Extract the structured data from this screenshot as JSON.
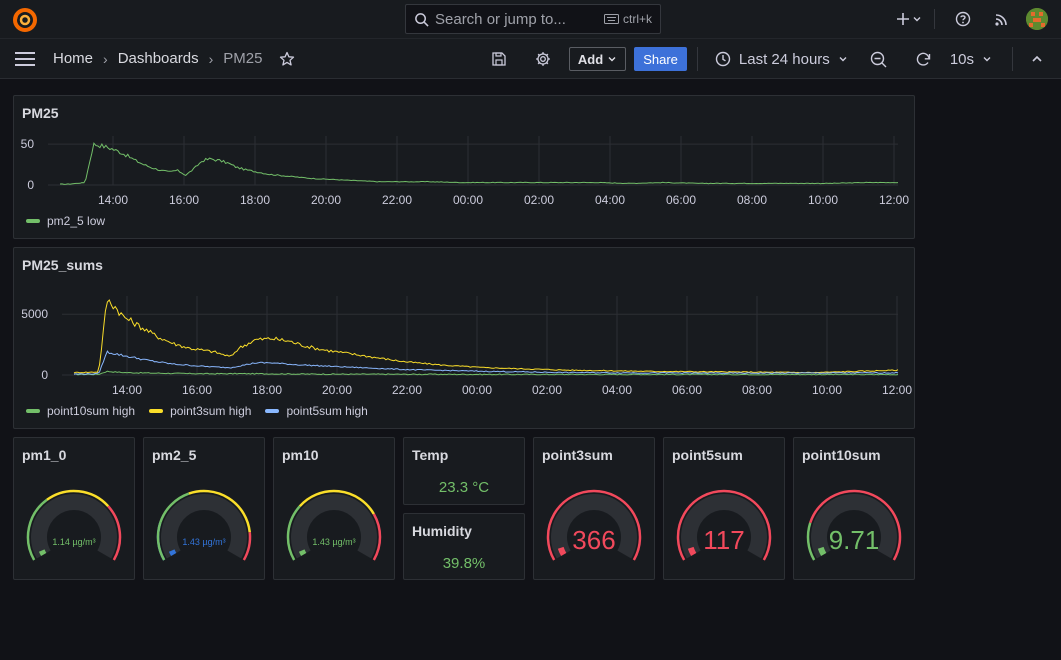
{
  "header": {
    "search_placeholder": "Search or jump to...",
    "search_shortcut": "ctrl+k",
    "icons": [
      "grafana-logo-icon",
      "search-icon",
      "keyboard-icon",
      "plus-icon",
      "chevron-down-icon",
      "help-icon",
      "news-icon",
      "avatar"
    ]
  },
  "nav": {
    "breadcrumbs": [
      "Home",
      "Dashboards",
      "PM25"
    ],
    "add_label": "Add",
    "share_label": "Share",
    "time_range": "Last 24 hours",
    "refresh_interval": "10s"
  },
  "colors": {
    "green": "#73bf69",
    "yellow": "#fade2a",
    "blue": "#8ab8ff",
    "red": "#f2495c",
    "blue_dark": "#3274d9",
    "orange": "#ff9830",
    "gauge_bg": "#2d3035"
  },
  "panels": {
    "pm25": {
      "title": "PM25",
      "legend": [
        "pm2_5 low"
      ],
      "chart_data": {
        "type": "line",
        "x_ticks": [
          "14:00",
          "16:00",
          "18:00",
          "20:00",
          "22:00",
          "00:00",
          "02:00",
          "04:00",
          "06:00",
          "08:00",
          "10:00",
          "12:00"
        ],
        "y_ticks": [
          "50",
          "0"
        ],
        "ylim": [
          0,
          60
        ],
        "grid": true,
        "series": [
          {
            "name": "pm2_5 low",
            "color": "#73bf69",
            "points": [
              [
                0,
                1
              ],
              [
                1,
                1
              ],
              [
                2,
                2
              ],
              [
                3,
                3
              ],
              [
                4,
                50
              ],
              [
                5,
                48
              ],
              [
                6,
                45
              ],
              [
                7,
                41
              ],
              [
                8,
                36
              ],
              [
                9,
                30
              ],
              [
                10,
                25
              ],
              [
                11,
                21
              ],
              [
                12,
                18
              ],
              [
                13,
                16
              ],
              [
                14,
                18
              ],
              [
                15,
                12
              ],
              [
                16,
                20
              ],
              [
                17,
                30
              ],
              [
                18,
                32
              ],
              [
                19,
                30
              ],
              [
                20,
                27
              ],
              [
                21,
                22
              ],
              [
                22,
                19
              ],
              [
                23,
                17
              ],
              [
                24,
                15
              ],
              [
                25,
                13
              ],
              [
                26,
                12
              ],
              [
                27,
                11
              ],
              [
                28,
                10
              ],
              [
                29,
                9
              ],
              [
                30,
                8
              ],
              [
                32,
                7
              ],
              [
                34,
                6
              ],
              [
                36,
                5
              ],
              [
                38,
                4
              ],
              [
                40,
                4
              ],
              [
                44,
                4
              ],
              [
                48,
                3
              ],
              [
                52,
                3
              ],
              [
                56,
                3
              ],
              [
                60,
                3
              ],
              [
                64,
                3
              ],
              [
                68,
                2
              ],
              [
                72,
                3
              ],
              [
                76,
                2
              ],
              [
                80,
                2
              ],
              [
                84,
                2
              ],
              [
                88,
                2
              ],
              [
                92,
                2
              ],
              [
                96,
                3
              ],
              [
                100,
                3
              ]
            ]
          }
        ]
      }
    },
    "pm25_sums": {
      "title": "PM25_sums",
      "legend": [
        "point10sum high",
        "point3sum high",
        "point5sum high"
      ],
      "chart_data": {
        "type": "line",
        "x_ticks": [
          "14:00",
          "16:00",
          "18:00",
          "20:00",
          "22:00",
          "00:00",
          "02:00",
          "04:00",
          "06:00",
          "08:00",
          "10:00",
          "12:00"
        ],
        "y_ticks": [
          "5000",
          "0"
        ],
        "ylim": [
          0,
          6500
        ],
        "grid": true,
        "series": [
          {
            "name": "point10sum high",
            "color": "#73bf69",
            "points": [
              [
                0,
                50
              ],
              [
                3,
                60
              ],
              [
                4,
                300
              ],
              [
                6,
                200
              ],
              [
                10,
                150
              ],
              [
                16,
                100
              ],
              [
                20,
                110
              ],
              [
                30,
                70
              ],
              [
                50,
                50
              ],
              [
                100,
                40
              ]
            ]
          },
          {
            "name": "point3sum high",
            "color": "#fade2a",
            "points": [
              [
                0,
                200
              ],
              [
                3,
                250
              ],
              [
                4,
                6200
              ],
              [
                5,
                5600
              ],
              [
                6,
                4800
              ],
              [
                8,
                4000
              ],
              [
                10,
                3200
              ],
              [
                12,
                2600
              ],
              [
                14,
                2200
              ],
              [
                16,
                2000
              ],
              [
                17,
                1900
              ],
              [
                18,
                1700
              ],
              [
                19,
                1500
              ],
              [
                20,
                2200
              ],
              [
                22,
                2900
              ],
              [
                24,
                3000
              ],
              [
                26,
                2800
              ],
              [
                28,
                2400
              ],
              [
                30,
                2100
              ],
              [
                33,
                1800
              ],
              [
                36,
                1500
              ],
              [
                40,
                1100
              ],
              [
                45,
                800
              ],
              [
                50,
                600
              ],
              [
                60,
                400
              ],
              [
                70,
                300
              ],
              [
                80,
                250
              ],
              [
                90,
                200
              ],
              [
                100,
                400
              ]
            ]
          },
          {
            "name": "point5sum high",
            "color": "#8ab8ff",
            "points": [
              [
                0,
                80
              ],
              [
                3,
                100
              ],
              [
                4,
                1900
              ],
              [
                6,
                1600
              ],
              [
                9,
                1200
              ],
              [
                12,
                900
              ],
              [
                16,
                700
              ],
              [
                19,
                600
              ],
              [
                22,
                1000
              ],
              [
                24,
                1000
              ],
              [
                27,
                850
              ],
              [
                30,
                750
              ],
              [
                35,
                600
              ],
              [
                40,
                450
              ],
              [
                50,
                300
              ],
              [
                60,
                200
              ],
              [
                80,
                150
              ],
              [
                100,
                180
              ]
            ]
          }
        ]
      }
    },
    "gauges": [
      {
        "title": "pm1_0",
        "value": "1.14 µg/m³",
        "fraction": 0.03,
        "value_color": "#73bf69",
        "small": true,
        "thresholds": [
          [
            "#73bf69",
            0,
            0.35
          ],
          [
            "#fade2a",
            0.35,
            0.7
          ],
          [
            "#f2495c",
            0.7,
            1
          ]
        ]
      },
      {
        "title": "pm2_5",
        "value": "1.43 µg/m³",
        "fraction": 0.03,
        "value_color": "#3274d9",
        "small": true,
        "thresholds": [
          [
            "#3274d9",
            0,
            0.2
          ],
          [
            "#73bf69",
            0,
            0.2
          ],
          [
            "#73bf69",
            0.2,
            0.42
          ],
          [
            "#fade2a",
            0.42,
            0.85
          ],
          [
            "#f2495c",
            0.85,
            1
          ]
        ]
      },
      {
        "title": "pm10",
        "value": "1.43 µg/m³",
        "fraction": 0.03,
        "value_color": "#73bf69",
        "small": true,
        "thresholds": [
          [
            "#73bf69",
            0,
            0.3
          ],
          [
            "#fade2a",
            0.3,
            0.75
          ],
          [
            "#f2495c",
            0.75,
            1
          ]
        ]
      },
      {
        "title": "point3sum",
        "value": "366",
        "fraction": 0.05,
        "value_color": "#f2495c",
        "small": false,
        "thresholds": [
          [
            "#f2495c",
            0,
            1
          ]
        ]
      },
      {
        "title": "point5sum",
        "value": "117",
        "fraction": 0.05,
        "value_color": "#f2495c",
        "small": false,
        "thresholds": [
          [
            "#f2495c",
            0,
            1
          ]
        ]
      },
      {
        "title": "point10sum",
        "value": "9.71",
        "fraction": 0.05,
        "value_color": "#73bf69",
        "small": false,
        "thresholds": [
          [
            "#73bf69",
            0,
            0.2
          ],
          [
            "#f2495c",
            0.2,
            1
          ]
        ]
      }
    ],
    "temp": {
      "title": "Temp",
      "value": "23.3 °C"
    },
    "humidity": {
      "title": "Humidity",
      "value": "39.8%"
    }
  }
}
